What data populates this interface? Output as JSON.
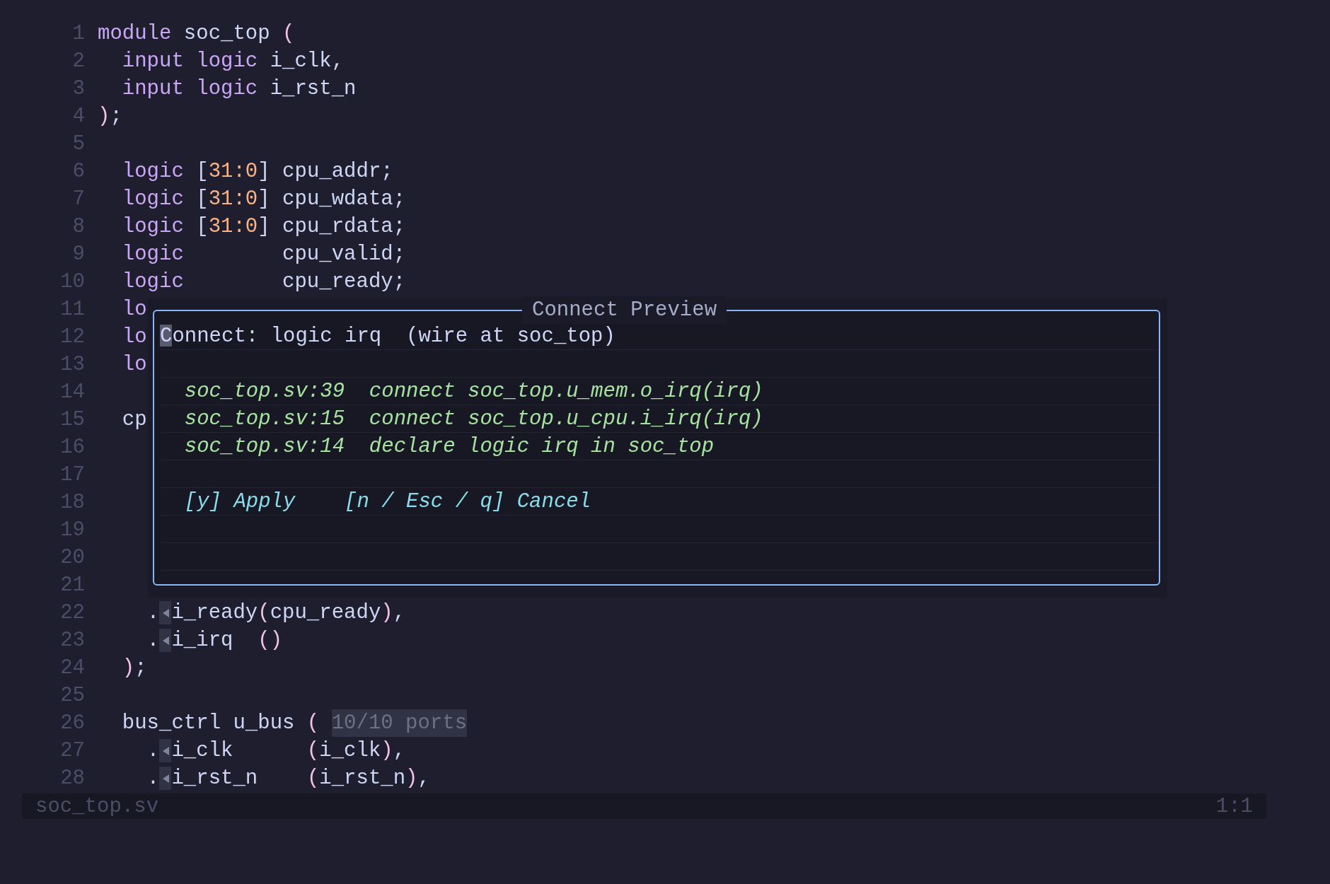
{
  "editor": {
    "lines": [
      {
        "number": "1",
        "tokens": [
          {
            "kind": "keyword",
            "text": "module"
          },
          {
            "kind": "plain",
            "text": " soc_top "
          },
          {
            "kind": "paren",
            "text": "("
          }
        ]
      },
      {
        "number": "2",
        "tokens": [
          {
            "kind": "keyword",
            "text": "  input logic"
          },
          {
            "kind": "plain",
            "text": " i_clk,"
          }
        ]
      },
      {
        "number": "3",
        "tokens": [
          {
            "kind": "keyword",
            "text": "  input logic"
          },
          {
            "kind": "plain",
            "text": " i_rst_n"
          }
        ]
      },
      {
        "number": "4",
        "tokens": [
          {
            "kind": "paren",
            "text": ")"
          },
          {
            "kind": "plain",
            "text": ";"
          }
        ]
      },
      {
        "number": "5"
      },
      {
        "number": "6",
        "tokens": [
          {
            "kind": "keyword",
            "text": "  logic "
          },
          {
            "kind": "plain",
            "text": "["
          },
          {
            "kind": "number",
            "text": "31:0"
          },
          {
            "kind": "plain",
            "text": "] cpu_addr;"
          }
        ]
      },
      {
        "number": "7",
        "tokens": [
          {
            "kind": "keyword",
            "text": "  logic "
          },
          {
            "kind": "plain",
            "text": "["
          },
          {
            "kind": "number",
            "text": "31:0"
          },
          {
            "kind": "plain",
            "text": "] cpu_wdata;"
          }
        ]
      },
      {
        "number": "8",
        "tokens": [
          {
            "kind": "keyword",
            "text": "  logic "
          },
          {
            "kind": "plain",
            "text": "["
          },
          {
            "kind": "number",
            "text": "31:0"
          },
          {
            "kind": "plain",
            "text": "] cpu_rdata;"
          }
        ]
      },
      {
        "number": "9",
        "tokens": [
          {
            "kind": "keyword",
            "text": "  logic"
          },
          {
            "kind": "plain",
            "text": "        cpu_valid;"
          }
        ]
      },
      {
        "number": "10",
        "tokens": [
          {
            "kind": "keyword",
            "text": "  logic"
          },
          {
            "kind": "plain",
            "text": "        cpu_ready;"
          }
        ]
      },
      {
        "number": "11",
        "tokens": [
          {
            "kind": "keyword",
            "text": "  lo"
          }
        ]
      },
      {
        "number": "12",
        "tokens": [
          {
            "kind": "keyword",
            "text": "  lo"
          }
        ]
      },
      {
        "number": "13",
        "tokens": [
          {
            "kind": "keyword",
            "text": "  lo"
          }
        ]
      },
      {
        "number": "14"
      },
      {
        "number": "15",
        "tokens": [
          {
            "kind": "plain",
            "text": "  cp"
          }
        ]
      },
      {
        "number": "16"
      },
      {
        "number": "17"
      },
      {
        "number": "18"
      },
      {
        "number": "19"
      },
      {
        "number": "20"
      },
      {
        "number": "21"
      },
      {
        "number": "22",
        "tokens": [
          {
            "kind": "plain",
            "text": "    ."
          },
          {
            "kind": "marker"
          },
          {
            "kind": "plain",
            "text": "i_ready"
          },
          {
            "kind": "paren",
            "text": "("
          },
          {
            "kind": "plain",
            "text": "cpu_ready"
          },
          {
            "kind": "paren",
            "text": ")"
          },
          {
            "kind": "plain",
            "text": ","
          }
        ]
      },
      {
        "number": "23",
        "tokens": [
          {
            "kind": "plain",
            "text": "    ."
          },
          {
            "kind": "marker"
          },
          {
            "kind": "plain",
            "text": "i_irq"
          },
          {
            "kind": "paren",
            "text": "  ()"
          }
        ]
      },
      {
        "number": "24",
        "tokens": [
          {
            "kind": "paren",
            "text": "  )"
          },
          {
            "kind": "plain",
            "text": ";"
          }
        ]
      },
      {
        "number": "25"
      },
      {
        "number": "26",
        "tokens": [
          {
            "kind": "plain",
            "text": "  bus_ctrl u_bus "
          },
          {
            "kind": "paren",
            "text": "( "
          },
          {
            "kind": "hint",
            "text": "10/10 ports"
          }
        ]
      },
      {
        "number": "27",
        "tokens": [
          {
            "kind": "plain",
            "text": "    ."
          },
          {
            "kind": "marker"
          },
          {
            "kind": "plain",
            "text": "i_clk"
          },
          {
            "kind": "paren",
            "text": "      ("
          },
          {
            "kind": "plain",
            "text": "i_clk"
          },
          {
            "kind": "paren",
            "text": ")"
          },
          {
            "kind": "plain",
            "text": ","
          }
        ]
      },
      {
        "number": "28",
        "tokens": [
          {
            "kind": "plain",
            "text": "    ."
          },
          {
            "kind": "marker"
          },
          {
            "kind": "plain",
            "text": "i_rst_n"
          },
          {
            "kind": "paren",
            "text": "    ("
          },
          {
            "kind": "plain",
            "text": "i_rst_n"
          },
          {
            "kind": "paren",
            "text": ")"
          },
          {
            "kind": "plain",
            "text": ","
          }
        ]
      }
    ]
  },
  "popup": {
    "title": "Connect Preview",
    "rows": [
      {
        "kind": "prompt",
        "text": "Connect: logic irq  (wire at soc_top)",
        "cursor": true
      },
      {
        "kind": "blank"
      },
      {
        "kind": "result",
        "location": "soc_top.sv:39",
        "action": "connect soc_top.u_mem.o_irq(irq)"
      },
      {
        "kind": "result",
        "location": "soc_top.sv:15",
        "action": "connect soc_top.u_cpu.i_irq(irq)"
      },
      {
        "kind": "result",
        "location": "soc_top.sv:14",
        "action": "declare logic irq in soc_top"
      },
      {
        "kind": "blank"
      },
      {
        "kind": "actions",
        "items": [
          {
            "text": "[y] Apply"
          },
          {
            "text": "[n / Esc / q] Cancel"
          }
        ]
      },
      {
        "kind": "blank"
      },
      {
        "kind": "blank"
      }
    ]
  },
  "status_bar": {
    "file": "soc_top.sv",
    "position": "1:1"
  }
}
